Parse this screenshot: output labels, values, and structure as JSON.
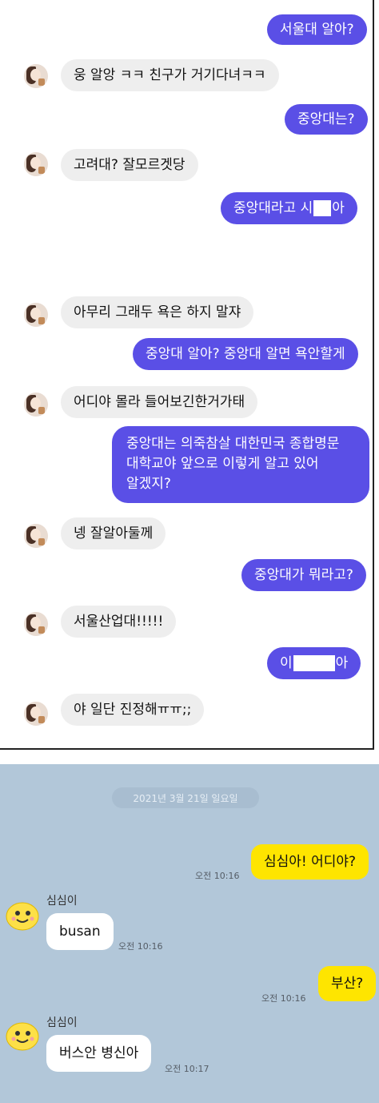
{
  "top_chat": {
    "messages": [
      {
        "sender": "me",
        "text": "서울대 알아?"
      },
      {
        "sender": "other",
        "text": "웅 알앙 ㅋㅋ 친구가 거기다녀ㅋㅋ"
      },
      {
        "sender": "me",
        "text": "중앙대는?"
      },
      {
        "sender": "other",
        "text": "고려대? 잘모르겟당"
      },
      {
        "sender": "me",
        "text_before": "중앙대라고 시",
        "text_after": "아"
      },
      {
        "sender": "other",
        "text": "아무리 그래두 욕은 하지 말쟈"
      },
      {
        "sender": "me",
        "text": "중앙대 알아? 중앙대 알면 욕안할게"
      },
      {
        "sender": "other",
        "text": "어디야 몰라 들어보긴한거가태"
      },
      {
        "sender": "me",
        "lines": [
          "중앙대는 의죽참살 대한민국 종합명문",
          "대학교야 앞으로 이렇게 알고 있어",
          "알겠지?"
        ]
      },
      {
        "sender": "other",
        "text": "넹 잘알아둘께"
      },
      {
        "sender": "me",
        "text": "중앙대가 뭐라고?"
      },
      {
        "sender": "other",
        "text": "서울산업대!!!!!"
      },
      {
        "sender": "me",
        "text_before": "이 ",
        "text_after": "아"
      },
      {
        "sender": "other",
        "text": "야 일단 진정해ㅠㅠ;;"
      }
    ]
  },
  "bottom_chat": {
    "date": "2021년 3월 21일 일요일",
    "messages": [
      {
        "sender": "me",
        "text": "심심아! 어디야?",
        "time": "오전 10:16"
      },
      {
        "sender": "bot",
        "name": "심심이",
        "text": "busan",
        "time": "오전 10:16"
      },
      {
        "sender": "me",
        "text": "부산?",
        "time": "오전 10:16"
      },
      {
        "sender": "bot",
        "name": "심심이",
        "text": "버스안 병신아",
        "time": "오전 10:17"
      }
    ]
  },
  "colors": {
    "my_bubble": "#5a4fe6",
    "other_bubble": "#eeeeee",
    "kakao_bg": "#b2c7d9",
    "kakao_yellow": "#fee500"
  }
}
